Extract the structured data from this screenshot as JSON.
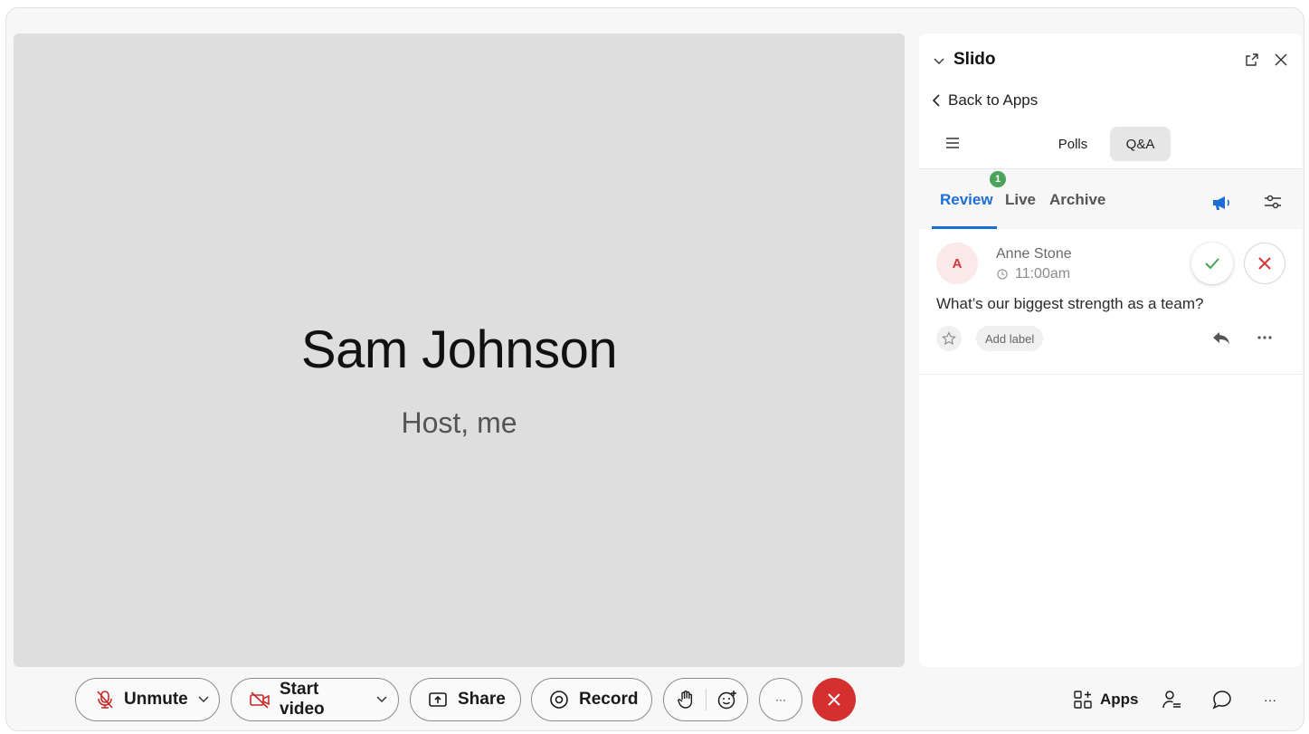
{
  "stage": {
    "participant_name": "Sam Johnson",
    "participant_role": "Host, me"
  },
  "panel": {
    "title": "Slido",
    "back_label": "Back to Apps",
    "segments": {
      "polls": "Polls",
      "qa": "Q&A",
      "selected": "Q&A"
    },
    "tabs": {
      "review": "Review",
      "live": "Live",
      "archive": "Archive",
      "active": "Review"
    },
    "live_badge_count": "1",
    "question": {
      "avatar_initial": "A",
      "author": "Anne Stone",
      "time": "11:00am",
      "text": "What’s our biggest strength as a team?",
      "add_label": "Add label"
    }
  },
  "controls": {
    "unmute_label": "Unmute",
    "start_video_label": "Start video",
    "share_label": "Share",
    "record_label": "Record",
    "more_label": "···",
    "apps_label": "Apps",
    "more_right_label": "···"
  },
  "icons": {
    "collapse": "chevron-down-icon",
    "popout": "popout-icon",
    "close": "close-icon",
    "back": "chevron-left-icon",
    "menu": "hamburger-menu-icon",
    "announce": "megaphone-icon",
    "filter": "sliders-icon",
    "clock": "clock-icon",
    "approve": "checkmark-icon",
    "dismiss": "x-icon",
    "star": "star-icon",
    "reply": "reply-icon",
    "more": "ellipsis-icon",
    "mic_muted": "microphone-muted-icon",
    "video_off": "video-off-icon",
    "share": "share-screen-icon",
    "record": "record-icon",
    "raise_hand": "raise-hand-icon",
    "reaction": "emoji-reaction-icon",
    "end_call": "end-call-icon",
    "apps": "apps-grid-icon",
    "participants": "participants-icon",
    "chat": "chat-bubble-icon"
  },
  "colors": {
    "accent": "#1b6fd4",
    "end_call": "#d62f2f",
    "approve": "#4aa45a",
    "dismiss": "#d33a3a",
    "badge": "#4aa45a",
    "muted_icon": "#c62828"
  }
}
